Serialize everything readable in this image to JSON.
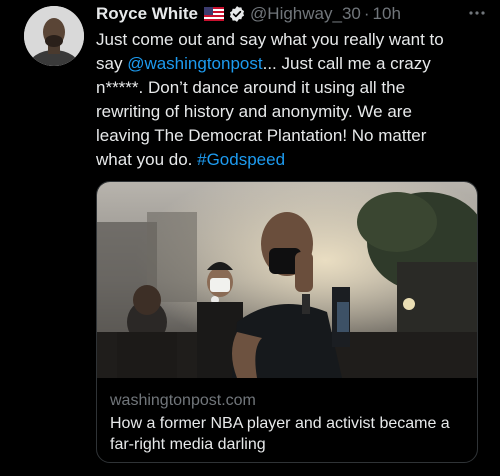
{
  "author": {
    "name": "Royce White",
    "handle": "@Highway_30",
    "separator": "·",
    "time": "10h"
  },
  "tweet": {
    "text_1": "Just come out and say what you really want to say ",
    "mention": "@washingtonpost",
    "text_2": "... Just call me a crazy n*****. Don’t dance around it using all the rewriting of history and anonymity. We are leaving The Democrat Plantation! No matter what you do. ",
    "hashtag": "#Godspeed"
  },
  "card": {
    "domain": "washingtonpost.com",
    "title": "How a former NBA player and activist became a far-right media darling"
  },
  "colors": {
    "background": "#000000",
    "text": "#e7e9ea",
    "secondary": "#71767b",
    "link": "#1d9bf0",
    "border": "#2f3336"
  },
  "icons": {
    "flag": "us-flag-icon",
    "verified": "verified-badge-icon",
    "more": "more-options-icon"
  }
}
